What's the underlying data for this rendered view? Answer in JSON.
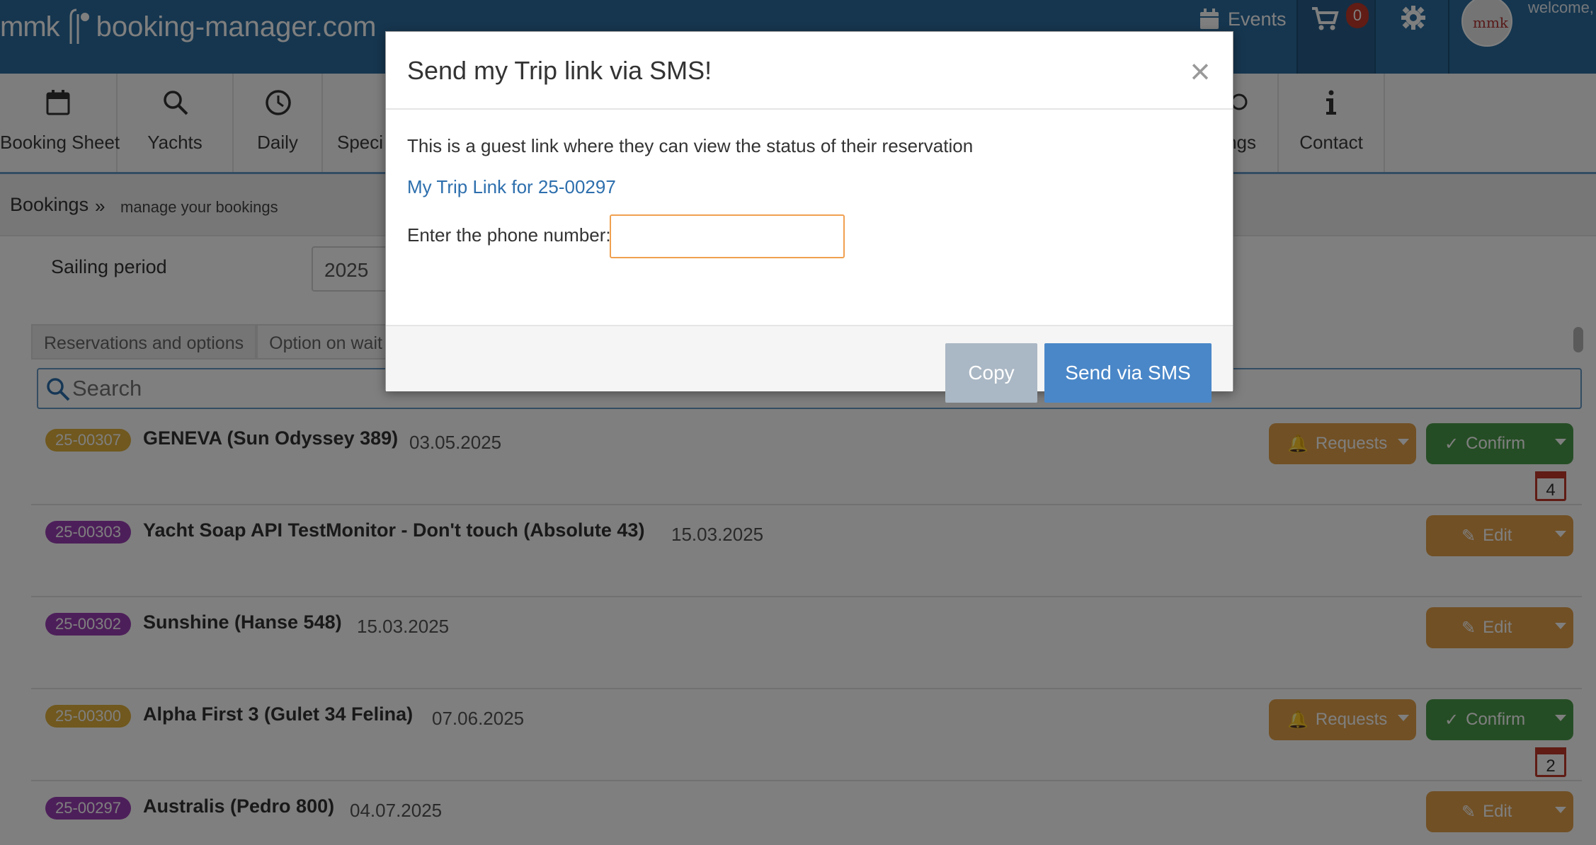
{
  "header": {
    "logo_left": "mmk",
    "logo_domain": "booking-manager.com",
    "events_label": "Events",
    "cart_count": "0",
    "avatar_text": "mmk",
    "welcome_text": "welcome,"
  },
  "nav": {
    "items": [
      {
        "label": "Booking Sheet",
        "icon": "calendar-icon"
      },
      {
        "label": "Yachts",
        "icon": "search-icon"
      },
      {
        "label": "Daily",
        "icon": "clock-icon"
      },
      {
        "label": "Speci",
        "icon": "gift-icon"
      },
      {
        "label": "ngs",
        "icon": "gear-icon"
      },
      {
        "label": "Contact",
        "icon": "info-icon"
      }
    ]
  },
  "breadcrumb": {
    "section": "Bookings",
    "subtitle": "manage your bookings"
  },
  "filters": {
    "sailing_period_label": "Sailing period",
    "year_value": "2025",
    "tabs": [
      "Reservations and options",
      "Option on wait"
    ],
    "search_placeholder": "Search"
  },
  "bookings": [
    {
      "number": "25-00307",
      "title": "GENEVA (Sun Odyssey 389)",
      "date": "03.05.2025",
      "status_color": "#e0b03c",
      "requests_label": "Requests",
      "confirm_label": "Confirm",
      "calendar_count": "4"
    },
    {
      "number": "25-00303",
      "title": "Yacht Soap API TestMonitor - Don't touch (Absolute 43)",
      "date": "15.03.2025",
      "status_color": "#9b3fb5",
      "edit_label": "Edit"
    },
    {
      "number": "25-00302",
      "title": "Sunshine (Hanse 548)",
      "date": "15.03.2025",
      "status_color": "#9b3fb5",
      "edit_label": "Edit"
    },
    {
      "number": "25-00300",
      "title": "Alpha First 3 (Gulet 34 Felina)",
      "date": "07.06.2025",
      "status_color": "#e0b03c",
      "requests_label": "Requests",
      "confirm_label": "Confirm",
      "calendar_count": "2"
    },
    {
      "number": "25-00297",
      "title": "Australis (Pedro 800)",
      "date": "04.07.2025",
      "status_color": "#9b3fb5",
      "edit_label": "Edit"
    }
  ],
  "modal": {
    "title": "Send my Trip link via SMS!",
    "close_symbol": "×",
    "description": "This is a guest link where they can view the status of their reservation",
    "trip_link_text": "My Trip Link for 25-00297",
    "phone_label": "Enter the phone number:",
    "phone_value": "",
    "copy_label": "Copy",
    "send_label": "Send via SMS"
  },
  "colors": {
    "header_bg": "#2d6d9f",
    "accent_blue": "#4a87c8",
    "link_blue": "#2d6fad",
    "orange": "#e2a04a",
    "green": "#4a9b4a",
    "badge_red": "#c0392b"
  }
}
